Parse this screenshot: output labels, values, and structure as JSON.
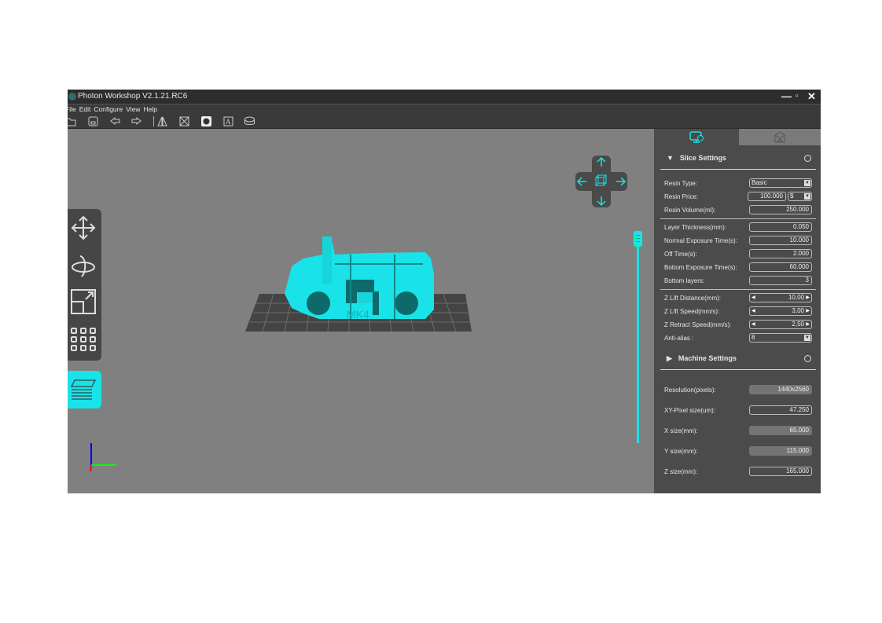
{
  "window": {
    "title": "Photon Workshop V2.1.21.RC6",
    "controls": [
      "—",
      "▫",
      "✕"
    ]
  },
  "menu": [
    "File",
    "Edit",
    "Configure",
    "View",
    "Help"
  ],
  "toolbar": [
    "open-icon",
    "save-icon",
    "undo-icon",
    "redo-icon",
    "mirror-icon",
    "support-icon",
    "hollow-icon",
    "text-icon",
    "base-icon"
  ],
  "viewport": {
    "model_label": "MK4"
  },
  "slice_settings": {
    "title": "Slice Settings",
    "resin_type": {
      "label": "Resin Type:",
      "value": "Basic"
    },
    "resin_price": {
      "label": "Resin Price:",
      "value": "100.000",
      "currency": "$"
    },
    "resin_volume": {
      "label": "Resin Volume(ml):",
      "value": "250.000"
    },
    "layer_thickness": {
      "label": "Layer Thickness(mm):",
      "value": "0.050"
    },
    "normal_exposure": {
      "label": "Normal Exposure Time(s):",
      "value": "10.000"
    },
    "off_time": {
      "label": "Off Time(s):",
      "value": "2.000"
    },
    "bottom_exposure": {
      "label": "Bottom Exposure Time(s):",
      "value": "60.000"
    },
    "bottom_layers": {
      "label": "Bottom layers:",
      "value": "3"
    },
    "z_lift_distance": {
      "label": "Z Lift Distance(mm):",
      "value": "10,00"
    },
    "z_lift_speed": {
      "label": "Z Lift Speed(mm/s):",
      "value": "3,00"
    },
    "z_retract_speed": {
      "label": "Z Retract Speed(mm/s):",
      "value": "2,50"
    },
    "anti_alias": {
      "label": "Anti-alias :",
      "value": "8"
    }
  },
  "machine_settings": {
    "title": "Machine Settings",
    "resolution": {
      "label": "Resolution(pixels):",
      "value": "1440x2560"
    },
    "xy_pixel": {
      "label": "XY-Pixel size(um):",
      "value": "47.250"
    },
    "x_size": {
      "label": "X size(mm):",
      "value": "65.000"
    },
    "y_size": {
      "label": "Y size(mm):",
      "value": "115.000"
    },
    "z_size": {
      "label": "Z size(mm):",
      "value": "165.000"
    }
  },
  "colors": {
    "accent": "#19e3e8",
    "panel": "#4b4b4b",
    "viewport": "#808080"
  }
}
